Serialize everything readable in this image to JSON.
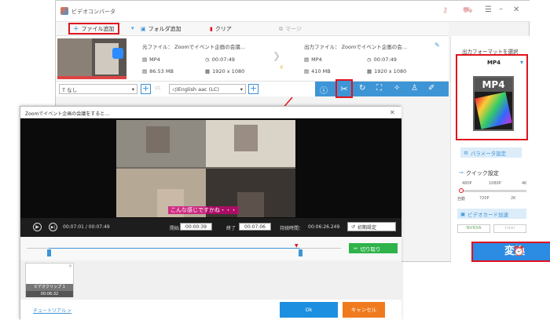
{
  "app": {
    "title": "ビデオコンバータ"
  },
  "toolbar": {
    "add_file": "ファイル追加",
    "add_folder": "フォルダ追加",
    "clear": "クリア",
    "merge": "マージ"
  },
  "source": {
    "label": "元ファイル： Zoomでイベント企画の会議…",
    "format": "MP4",
    "duration": "00:07:49",
    "size": "86.53 MB",
    "resolution": "1920 x 1080"
  },
  "output": {
    "label": "出力ファイル： Zoomでイベント企画の会…",
    "format": "MP4",
    "duration": "00:07:49",
    "size": "410 MB",
    "resolution": "1920 x 1080"
  },
  "options": {
    "subtitle": "なし",
    "audio": "English aac (LC)"
  },
  "right_panel": {
    "title": "出力フォーマットを選択",
    "format": "MP4",
    "format_icon_text": "MP4",
    "params": "パラメータ設定",
    "quick_settings": "クイック設定",
    "quality_top": [
      "480P",
      "1080P",
      "4K"
    ],
    "quality_bottom": [
      "自動",
      "720P",
      "2K"
    ],
    "gpu_accel": "ビデオカード加速",
    "gpu_brands": [
      "NVIDIA",
      "Intel"
    ],
    "convert": "変換"
  },
  "dialog": {
    "title": "Zoomでイベント企画の会議をすると…",
    "subtitle_caption": "こんな感じですかね・・・",
    "current_time": "00:07:01 / 00:07:49",
    "start_label": "開始",
    "start_value": "00:00:39",
    "end_label": "終了",
    "end_value": "00:07:06",
    "duration_label": "持続時間：",
    "duration_value": "00:06:26.249",
    "reset": "初期設定",
    "cut": "切り取り",
    "clip_name": "ビデオクリップ 1",
    "clip_duration": "00:06:32",
    "tutorial": "チュートリアル >",
    "ok": "Ok",
    "cancel": "キャンセル"
  },
  "colors": {
    "accent_blue": "#3e95d6",
    "highlight_red": "#e0141e",
    "cut_green": "#2fb34a",
    "ok_blue": "#1d8fe1",
    "cancel_orange": "#f07b1f"
  }
}
